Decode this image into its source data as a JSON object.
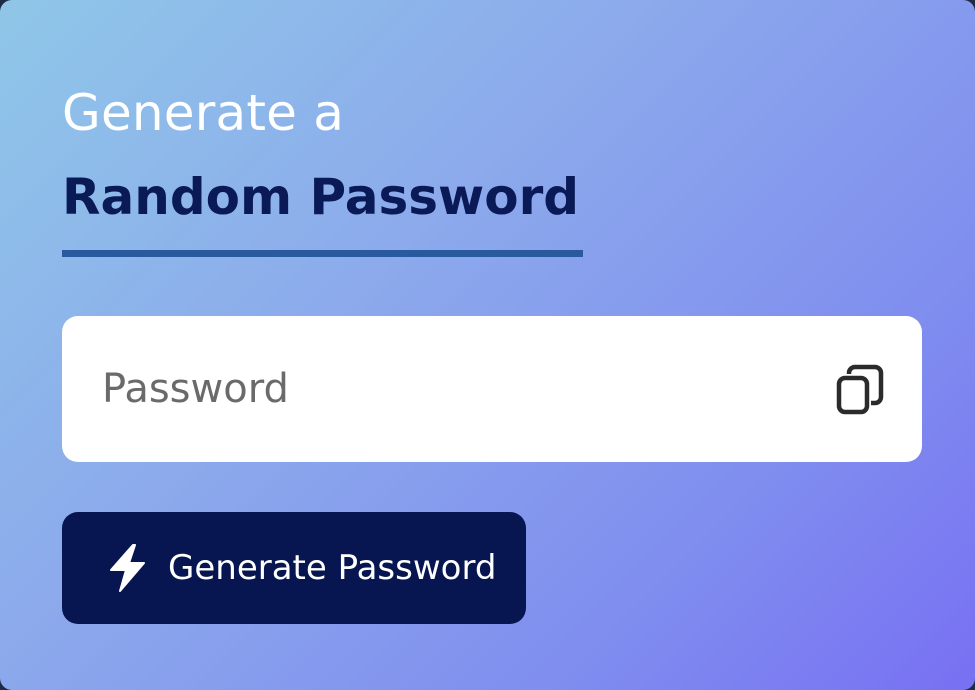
{
  "header": {
    "line1": "Generate a",
    "line2": "Random Password"
  },
  "password_field": {
    "value": "",
    "placeholder": "Password",
    "copy_icon": "copy-icon"
  },
  "generate_button": {
    "label": "Generate Password",
    "icon": "lightning-bolt-icon"
  },
  "colors": {
    "accent_dark": "#071650",
    "underline": "#2a5a9e",
    "gradient_start": "#8fc7e8",
    "gradient_end": "#7870f3"
  }
}
